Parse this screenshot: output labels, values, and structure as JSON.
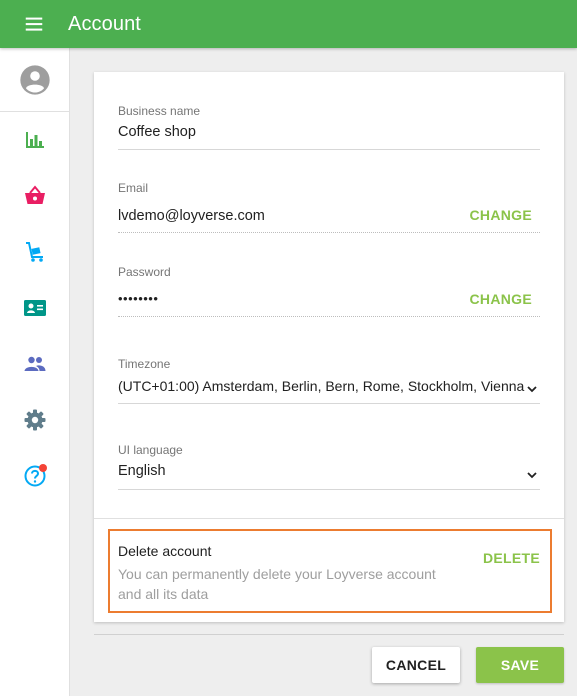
{
  "header": {
    "title": "Account"
  },
  "sidebar": {
    "items": [
      {
        "icon": "bar-chart-icon",
        "color": "#4caf50"
      },
      {
        "icon": "basket-icon",
        "color": "#e91e63"
      },
      {
        "icon": "cart-icon",
        "color": "#03a9f4"
      },
      {
        "icon": "id-card-icon",
        "color": "#009688"
      },
      {
        "icon": "people-icon",
        "color": "#5c6bc0"
      },
      {
        "icon": "gear-icon",
        "color": "#607d8b"
      },
      {
        "icon": "help-icon",
        "color": "#03a9f4",
        "badge": true
      }
    ]
  },
  "form": {
    "business_name": {
      "label": "Business name",
      "value": "Coffee shop"
    },
    "email": {
      "label": "Email",
      "value": "lvdemo@loyverse.com",
      "action": "CHANGE"
    },
    "password": {
      "label": "Password",
      "value": "••••••••",
      "action": "CHANGE"
    },
    "timezone": {
      "label": "Timezone",
      "value": "(UTC+01:00) Amsterdam, Berlin, Bern, Rome, Stockholm, Vienna"
    },
    "ui_language": {
      "label": "UI language",
      "value": "English"
    }
  },
  "delete_account": {
    "title": "Delete account",
    "description": "You can permanently delete your Loyverse account and all its data",
    "action": "DELETE"
  },
  "footer": {
    "cancel_label": "CANCEL",
    "save_label": "SAVE"
  },
  "colors": {
    "primary": "#4caf50",
    "accent": "#8bc34a",
    "highlight_border": "#ec7c30"
  }
}
